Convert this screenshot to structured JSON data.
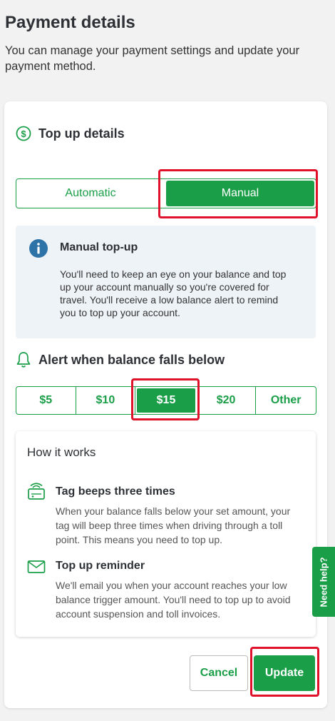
{
  "page": {
    "title": "Payment details",
    "subtitle": "You can manage your payment settings and update your payment method."
  },
  "topup": {
    "heading": "Top up details",
    "modes": [
      "Automatic",
      "Manual"
    ],
    "selected_mode": "Manual",
    "info_title": "Manual top-up",
    "info_body": "You'll need to keep an eye on your balance and top up your account manually so you're covered for travel. You'll receive a low balance alert to remind you to top up your account."
  },
  "alert": {
    "heading": "Alert when balance falls below",
    "amounts": [
      "$5",
      "$10",
      "$15",
      "$20",
      "Other"
    ],
    "selected_amount": "$15"
  },
  "how_it_works": {
    "title": "How it works",
    "items": [
      {
        "icon": "tag-beep-icon",
        "title": "Tag beeps three times",
        "body": "When your balance falls below your set amount, your tag will beep three times when driving through a toll point. This means you need to top up."
      },
      {
        "icon": "envelope-icon",
        "title": "Top up reminder",
        "body": "We'll email you when your account reaches your low balance trigger amount. You'll need to top up to avoid account suspension and toll invoices."
      }
    ]
  },
  "actions": {
    "cancel_label": "Cancel",
    "update_label": "Update"
  },
  "help_tab": {
    "label": "Need help?"
  },
  "colors": {
    "brand_green": "#1a9e48",
    "highlight_red": "#e0112b",
    "info_bg": "#eef3f8",
    "info_icon_blue": "#2e73a8"
  }
}
